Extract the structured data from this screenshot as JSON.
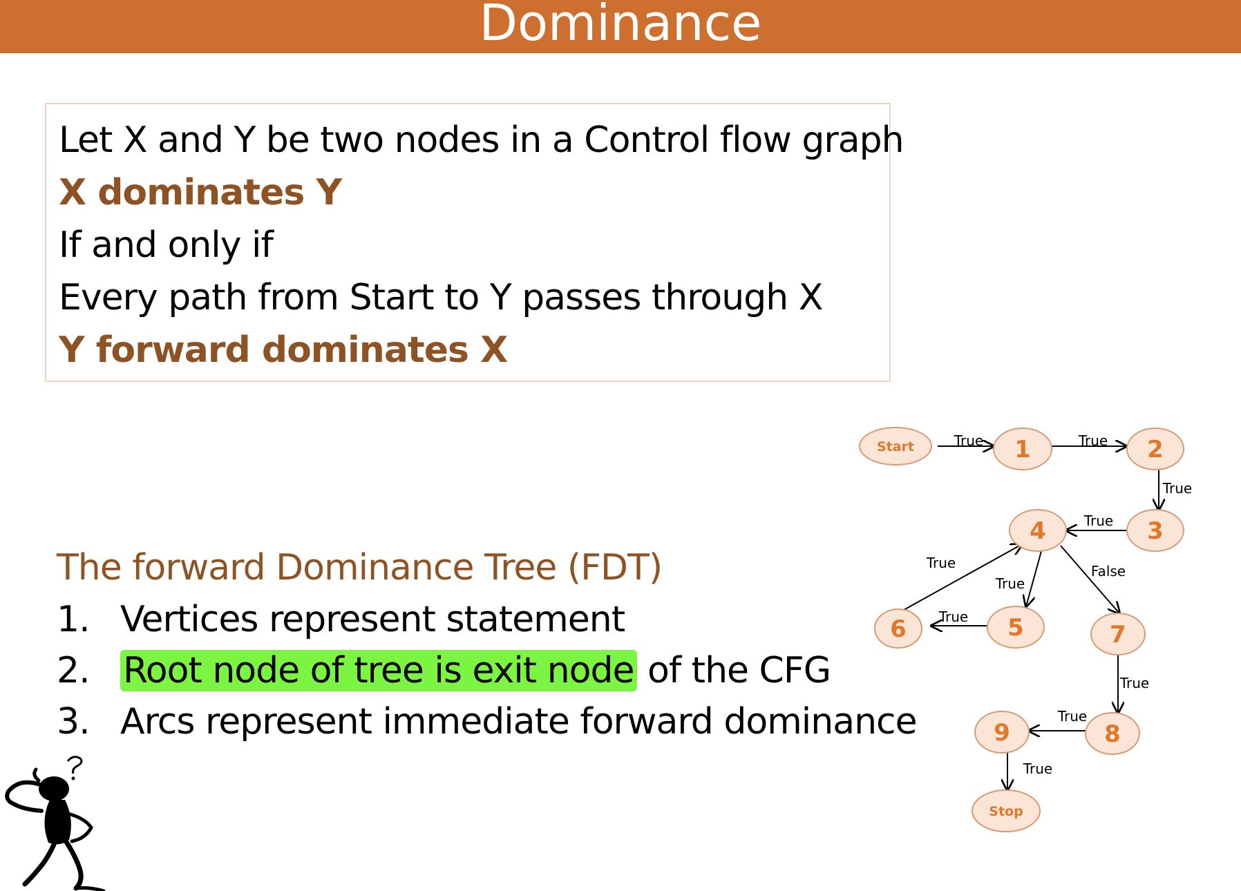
{
  "title": "Dominance",
  "definition": {
    "lines": [
      {
        "text": "Let X and Y be two nodes in a Control flow graph",
        "style": "normal"
      },
      {
        "text": "X dominates Y",
        "style": "accent"
      },
      {
        "text": "If and only if",
        "style": "normal"
      },
      {
        "text": "Every path from Start to Y passes through X",
        "style": "normal"
      },
      {
        "text": "Y forward dominates X",
        "style": "accent"
      }
    ]
  },
  "fdt": {
    "heading": "The forward Dominance Tree (FDT)",
    "items": [
      {
        "num": "1.",
        "text": "Vertices represent statement"
      },
      {
        "num": "2.",
        "highlight": "Root node of tree is exit node",
        "rest": " of the CFG"
      },
      {
        "num": "3.",
        "text": "Arcs represent immediate forward dominance"
      }
    ]
  },
  "graph": {
    "node_fill": "#fbe5d6",
    "node_stroke": "#d89a74",
    "node_text_color": "#e0782c",
    "nodes": [
      {
        "id": "start",
        "label": "Start"
      },
      {
        "id": "n1",
        "label": "1"
      },
      {
        "id": "n2",
        "label": "2"
      },
      {
        "id": "n3",
        "label": "3"
      },
      {
        "id": "n4",
        "label": "4"
      },
      {
        "id": "n5",
        "label": "5"
      },
      {
        "id": "n6",
        "label": "6"
      },
      {
        "id": "n7",
        "label": "7"
      },
      {
        "id": "n8",
        "label": "8"
      },
      {
        "id": "n9",
        "label": "9"
      },
      {
        "id": "stop",
        "label": "Stop"
      }
    ],
    "edges": [
      {
        "from": "start",
        "to": "n1",
        "label": "True"
      },
      {
        "from": "n1",
        "to": "n2",
        "label": "True"
      },
      {
        "from": "n2",
        "to": "n3",
        "label": "True"
      },
      {
        "from": "n3",
        "to": "n4",
        "label": "True"
      },
      {
        "from": "n4",
        "to": "n5",
        "label": "True"
      },
      {
        "from": "n4",
        "to": "n7",
        "label": "False"
      },
      {
        "from": "n5",
        "to": "n6",
        "label": "True"
      },
      {
        "from": "n6",
        "to": "n4",
        "label": "True"
      },
      {
        "from": "n7",
        "to": "n8",
        "label": "True"
      },
      {
        "from": "n8",
        "to": "n9",
        "label": "True"
      },
      {
        "from": "n9",
        "to": "stop",
        "label": "True"
      }
    ]
  },
  "colors": {
    "title_bar": "#cd6f2f",
    "accent_text": "#8e5324",
    "highlight": "#7cf542",
    "box_border": "#f1d2bd"
  }
}
